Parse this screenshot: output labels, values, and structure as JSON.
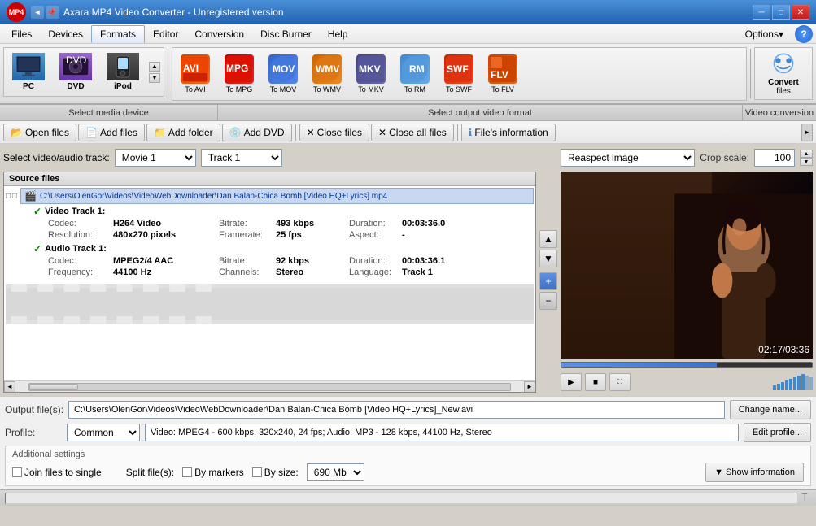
{
  "titlebar": {
    "title": "Axara MP4 Video Converter - Unregistered version",
    "logo": "MP4"
  },
  "menu": {
    "items": [
      "Files",
      "Devices",
      "Formats",
      "Editor",
      "Conversion",
      "Disc Burner",
      "Help"
    ],
    "active": "Formats",
    "right": [
      "Options▾",
      "?"
    ]
  },
  "toolbar": {
    "devices": {
      "label": "Select media device",
      "items": [
        {
          "label": "PC",
          "icon": "PC"
        },
        {
          "label": "DVD",
          "icon": "DVD"
        },
        {
          "label": "iPod",
          "icon": "iPod"
        }
      ]
    },
    "formats": {
      "label": "Select output video format",
      "items": [
        {
          "label": "To AVI",
          "color": "#cc4400"
        },
        {
          "label": "To MPG",
          "color": "#cc0000"
        },
        {
          "label": "To MOV",
          "color": "#3366cc"
        },
        {
          "label": "To WMV",
          "color": "#cc6600"
        },
        {
          "label": "To MKV",
          "color": "#444488"
        },
        {
          "label": "To RM",
          "color": "#4488cc"
        },
        {
          "label": "To SWF",
          "color": "#cc2200"
        },
        {
          "label": "To FLV",
          "color": "#cc4400"
        }
      ]
    },
    "convert": {
      "label": "Video conversion",
      "button": "Convert\nfiles"
    }
  },
  "actionbar": {
    "buttons": [
      {
        "label": "Open files",
        "icon": "📂"
      },
      {
        "label": "Add files",
        "icon": "📄"
      },
      {
        "label": "Add folder",
        "icon": "📁"
      },
      {
        "label": "Add DVD",
        "icon": "💿"
      },
      {
        "label": "Close files",
        "icon": "❌"
      },
      {
        "label": "Close all files",
        "icon": "❌"
      },
      {
        "label": "File's information",
        "icon": "ℹ"
      }
    ]
  },
  "track_selector": {
    "label": "Select video/audio track:",
    "video": "Movie 1",
    "audio": "Track 1"
  },
  "source_files": {
    "header": "Source files",
    "file_path": "C:\\Users\\OlenGor\\Videos\\VideoWebDownloader\\Dan Balan-Chica Bomb [Video HQ+Lyrics].mp4",
    "tracks": [
      {
        "title": "Video Track 1:",
        "checked": true,
        "details": [
          {
            "label": "Codec:",
            "value": "H264 Video"
          },
          {
            "label": "Resolution:",
            "value": "480x270 pixels"
          },
          {
            "label": "Bitrate:",
            "value": "493 kbps"
          },
          {
            "label": "Framerate:",
            "value": "25 fps"
          },
          {
            "label": "Duration:",
            "value": "00:03:36.0"
          },
          {
            "label": "Aspect:",
            "value": "-"
          }
        ]
      },
      {
        "title": "Audio Track 1:",
        "checked": true,
        "details": [
          {
            "label": "Codec:",
            "value": "MPEG2/4 AAC"
          },
          {
            "label": "Frequency:",
            "value": "44100 Hz"
          },
          {
            "label": "Bitrate:",
            "value": "92 kbps"
          },
          {
            "label": "Channels:",
            "value": "Stereo"
          },
          {
            "label": "Duration:",
            "value": "00:03:36.1"
          },
          {
            "label": "Language:",
            "value": "Track 1"
          }
        ]
      }
    ]
  },
  "preview": {
    "mode": "Reaspect image",
    "crop_label": "Crop scale:",
    "crop_value": "100",
    "time_current": "02:17",
    "time_total": "03:36"
  },
  "output": {
    "label": "Output file(s):",
    "path": "C:\\Users\\OlenGor\\Videos\\VideoWebDownloader\\Dan Balan-Chica Bomb [Video HQ+Lyrics]_New.avi",
    "change_btn": "Change name..."
  },
  "profile": {
    "label": "Profile:",
    "selected": "Common",
    "description": "Video: MPEG4 - 600 kbps, 320x240, 24 fps; Audio: MP3 - 128 kbps, 44100 Hz, Stereo",
    "edit_btn": "Edit profile..."
  },
  "additional": {
    "title": "Additional settings",
    "join_label": "Join files to single",
    "split_label": "Split file(s):",
    "by_markers_label": "By markers",
    "by_size_label": "By size:",
    "size_value": "690 Mb",
    "show_info_btn": "▼ Show information"
  }
}
